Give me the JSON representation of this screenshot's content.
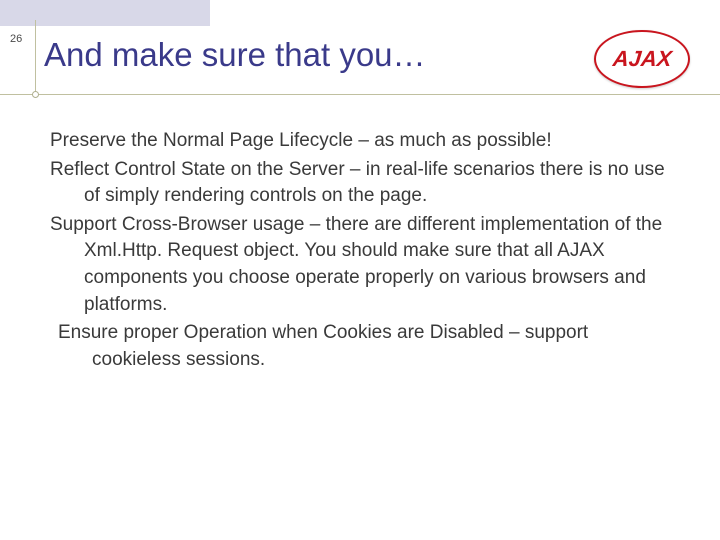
{
  "page_number": "26",
  "title": "And make sure that you…",
  "logo_text": "AJAX",
  "content": {
    "items": [
      "Preserve the Normal Page Lifecycle – as much as possible!",
      "Reflect Control State on the Server – in real-life scenarios there is no use of simply rendering controls on the page.",
      "Support Cross-Browser usage – there are different implementation of the Xml.Http. Request object. You should make sure that all AJAX components you choose operate properly on various browsers and platforms.",
      "Ensure proper Operation when Cookies are Disabled – support cookieless sessions."
    ]
  }
}
